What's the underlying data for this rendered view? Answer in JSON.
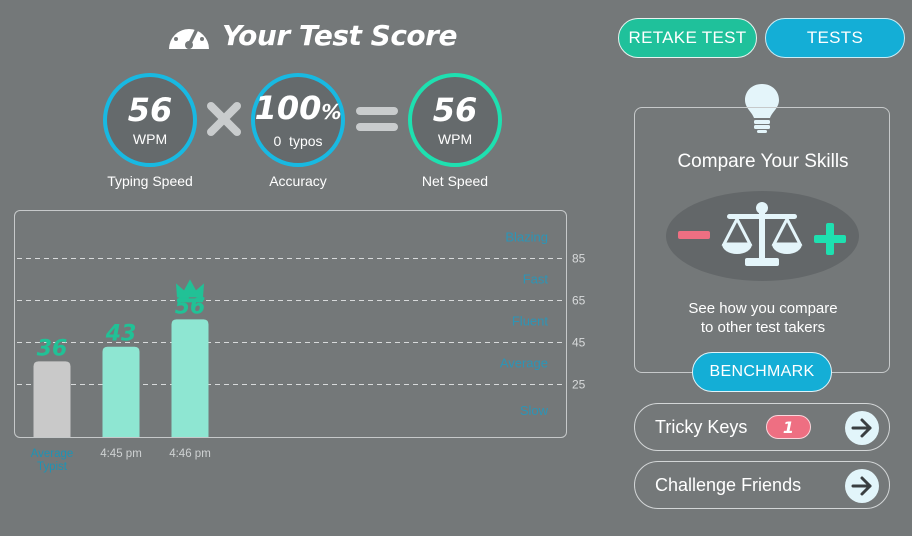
{
  "header": {
    "title": "Your Test Score",
    "title_icon": "speedometer-icon",
    "retake_label": "RETAKE TEST",
    "tests_label": "TESTS"
  },
  "scores": {
    "typing_speed": {
      "value": "56",
      "unit": "WPM",
      "caption": "Typing Speed"
    },
    "accuracy": {
      "value": "100",
      "suffix": "%",
      "unit": "0  typos",
      "caption": "Accuracy"
    },
    "net_speed": {
      "value": "56",
      "unit": "WPM",
      "caption": "Net Speed"
    },
    "operator_icons": [
      "multiply-icon",
      "equals-icon"
    ]
  },
  "chart_data": {
    "type": "bar",
    "categories": [
      "Average Typist",
      "4:45 pm",
      "4:46 pm"
    ],
    "values": [
      36,
      43,
      56
    ],
    "data_labels": [
      "36",
      "43",
      "56"
    ],
    "bar_colors": [
      "#c9c9c9",
      "#8ee6d2",
      "#8ee6d2"
    ],
    "best_marker": "crown-icon",
    "best_index": 2,
    "ylim": [
      0,
      100
    ],
    "gridlines": [
      85,
      65,
      45,
      25
    ],
    "grid_labels": [
      "85",
      "65",
      "45",
      "25"
    ],
    "zones": [
      {
        "label": "Blazing",
        "value": 95
      },
      {
        "label": "Fast",
        "value": 75
      },
      {
        "label": "Fluent",
        "value": 55
      },
      {
        "label": "Average",
        "value": 35
      },
      {
        "label": "Slow",
        "value": 12.5
      }
    ]
  },
  "compare_panel": {
    "icon": "lightbulb-icon",
    "title": "Compare Your Skills",
    "scale_icon": "balance-scale-icon",
    "minus_icon": "minus-icon",
    "plus_icon": "plus-icon",
    "desc_line1": "See how you compare",
    "desc_line2": "to other test takers",
    "button_label": "BENCHMARK"
  },
  "actions": {
    "tricky_keys": {
      "label": "Tricky Keys",
      "count": "1",
      "icon": "arrow-right-icon"
    },
    "challenge": {
      "label": "Challenge Friends",
      "icon": "arrow-right-icon"
    }
  },
  "colors": {
    "background": "#747879",
    "accent_green": "#1fc19b",
    "accent_blue": "#14aed6",
    "bar_highlight": "#8ee6d2",
    "badge_pink": "#ee6f82"
  }
}
